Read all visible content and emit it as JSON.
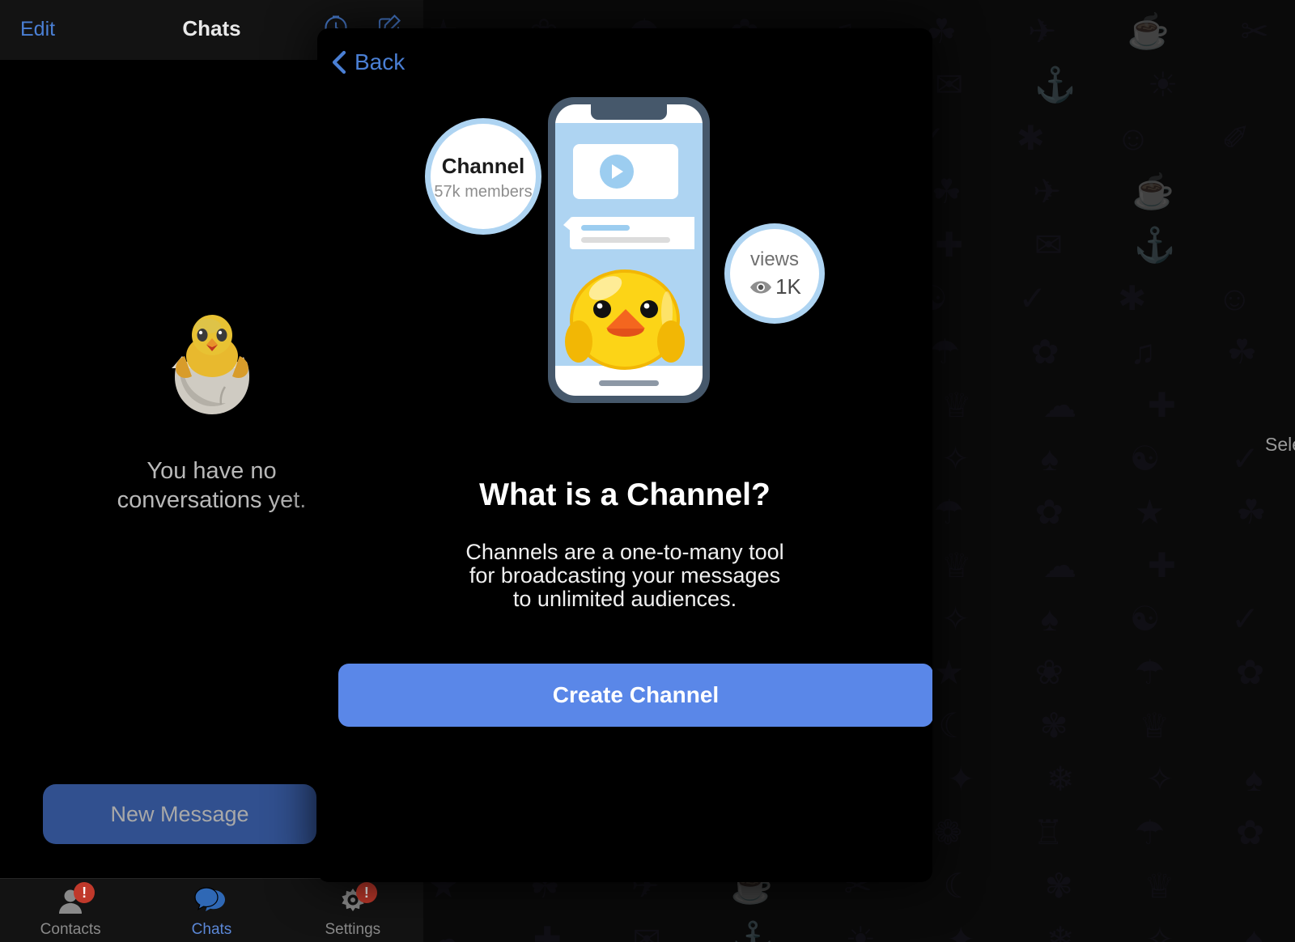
{
  "sidebar": {
    "header": {
      "edit_label": "Edit",
      "title": "Chats",
      "icons": [
        {
          "name": "timer-icon"
        },
        {
          "name": "compose-icon"
        }
      ]
    },
    "empty_state": {
      "icon": "hatching-chick-emoji",
      "line1": "You have no",
      "line2": "conversations yet."
    },
    "new_message_label": "New Message",
    "tabs": [
      {
        "label": "Contacts",
        "icon": "contacts-icon",
        "badge": "!",
        "active": false
      },
      {
        "label": "Chats",
        "icon": "chats-icon",
        "badge": "",
        "active": true
      },
      {
        "label": "Settings",
        "icon": "settings-gear-icon",
        "badge": "!",
        "active": false
      }
    ]
  },
  "right_pane": {
    "hint_text": "Select a chat to start messaging",
    "wallpaper": "doodle-pattern"
  },
  "modal": {
    "back_label": "Back",
    "illustration": {
      "name": "channel-phone-illustration",
      "bubble_channel_title": "Channel",
      "bubble_channel_subtitle": "57k members",
      "bubble_views_label": "views",
      "bubble_views_count": "1K",
      "sticker": "duck-sticker"
    },
    "title": "What is a Channel?",
    "body_lines": [
      "Channels are a one-to-many tool",
      "for broadcasting your messages",
      "to unlimited audiences."
    ],
    "create_button_label": "Create Channel"
  },
  "colors": {
    "accent_blue": "#4a7fd4",
    "button_blue": "#5a87e8",
    "new_message_blue": "#31508f",
    "badge_red": "#c0392b",
    "header_bg": "#131313",
    "panel_bg": "#000000"
  }
}
